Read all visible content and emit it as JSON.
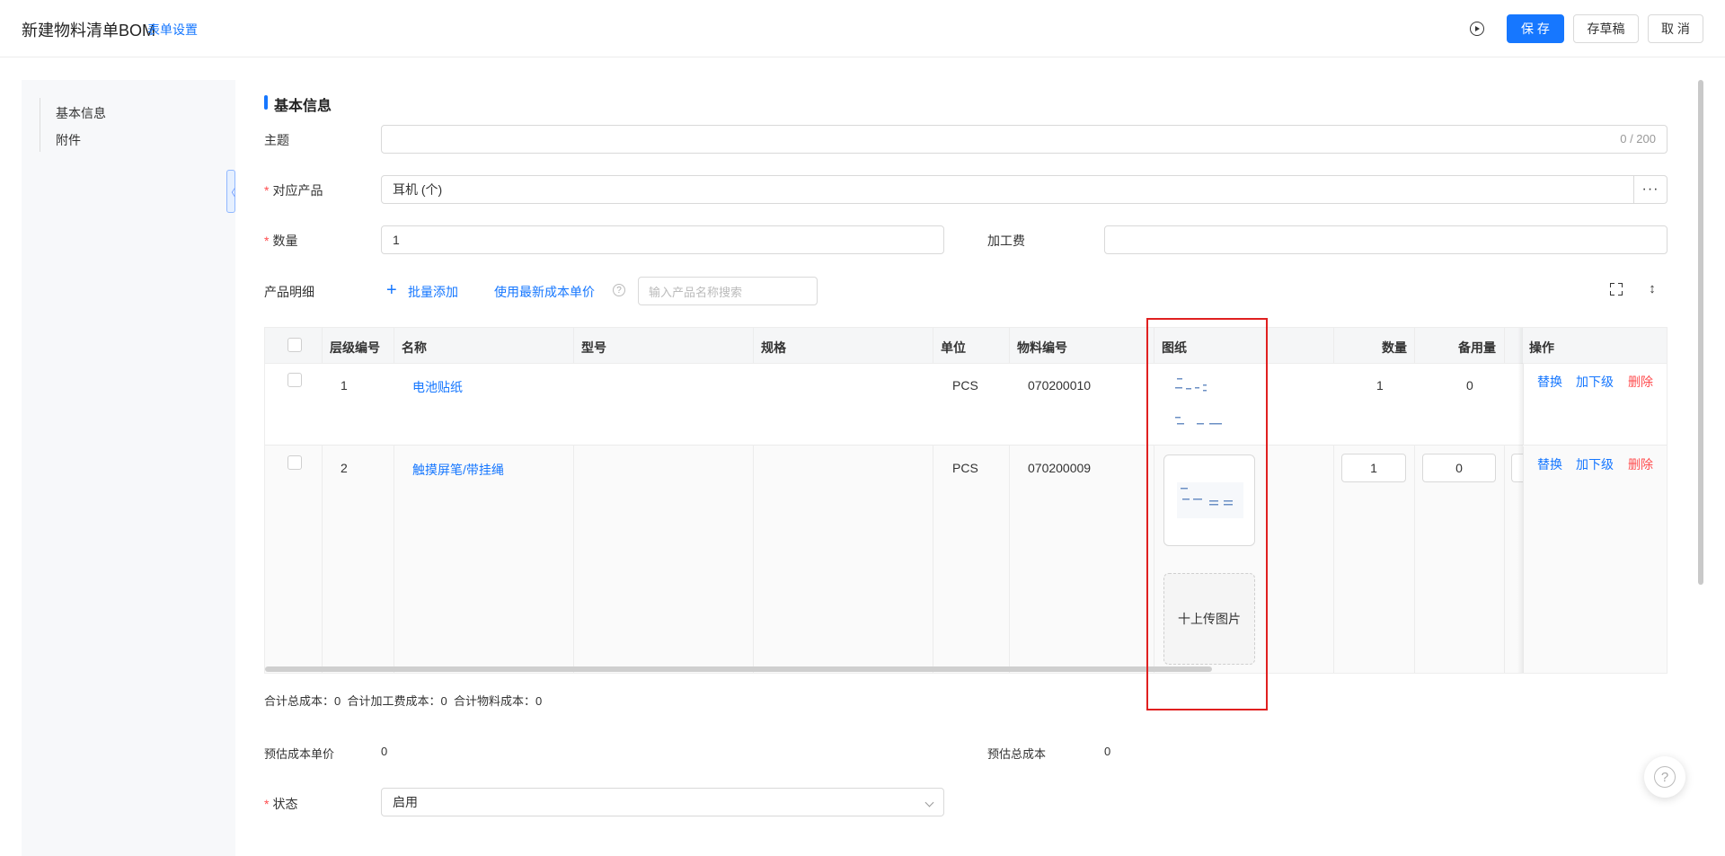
{
  "header": {
    "title": "新建物料清单BOM",
    "form_settings": "表单设置",
    "save": "保 存",
    "draft": "存草稿",
    "cancel": "取 消"
  },
  "leftnav": {
    "items": [
      "基本信息",
      "附件"
    ],
    "collapse_glyph": "〈"
  },
  "section": {
    "title": "基本信息"
  },
  "form": {
    "subject_label": "主题",
    "subject_value": "",
    "subject_counter": "0 / 200",
    "product_label": "对应产品",
    "product_value": "耳机 (个)",
    "product_more": "···",
    "qty_label": "数量",
    "qty_value": "1",
    "fee_label": "加工费",
    "fee_value": "",
    "required_mark": "*"
  },
  "detail": {
    "label": "产品明细",
    "batch_add": "批量添加",
    "use_latest_cost": "使用最新成本单价",
    "search_placeholder": "输入产品名称搜索"
  },
  "table": {
    "columns": {
      "level": "层级编号",
      "name": "名称",
      "model": "型号",
      "spec": "规格",
      "unit": "单位",
      "code": "物料编号",
      "drawing": "图纸",
      "qty": "数量",
      "spare": "备用量",
      "ops": "操作"
    },
    "rows": [
      {
        "level": "1",
        "name": "电池贴纸",
        "model": "",
        "spec": "",
        "unit": "PCS",
        "code": "070200010",
        "qty": "1",
        "spare": "0"
      },
      {
        "level": "2",
        "name": "触摸屏笔/带挂绳",
        "model": "",
        "spec": "",
        "unit": "PCS",
        "code": "070200009",
        "qty": "1",
        "spare": "0"
      }
    ],
    "actions": {
      "replace": "替换",
      "add_child": "加下级",
      "delete": "删除"
    },
    "upload": "十上传图片"
  },
  "summary": {
    "total_cost": "合计总成本：0",
    "total_fee": "合计加工费成本：0",
    "total_material": "合计物料成本：0"
  },
  "estimates": {
    "unit_cost_label": "预估成本单价",
    "unit_cost_value": "0",
    "total_cost_label": "预估总成本",
    "total_cost_value": "0"
  },
  "status": {
    "label": "状态",
    "value": "启用"
  },
  "colors": {
    "primary": "#1677ff",
    "danger": "#ff4d4f",
    "highlight": "#e02020"
  }
}
